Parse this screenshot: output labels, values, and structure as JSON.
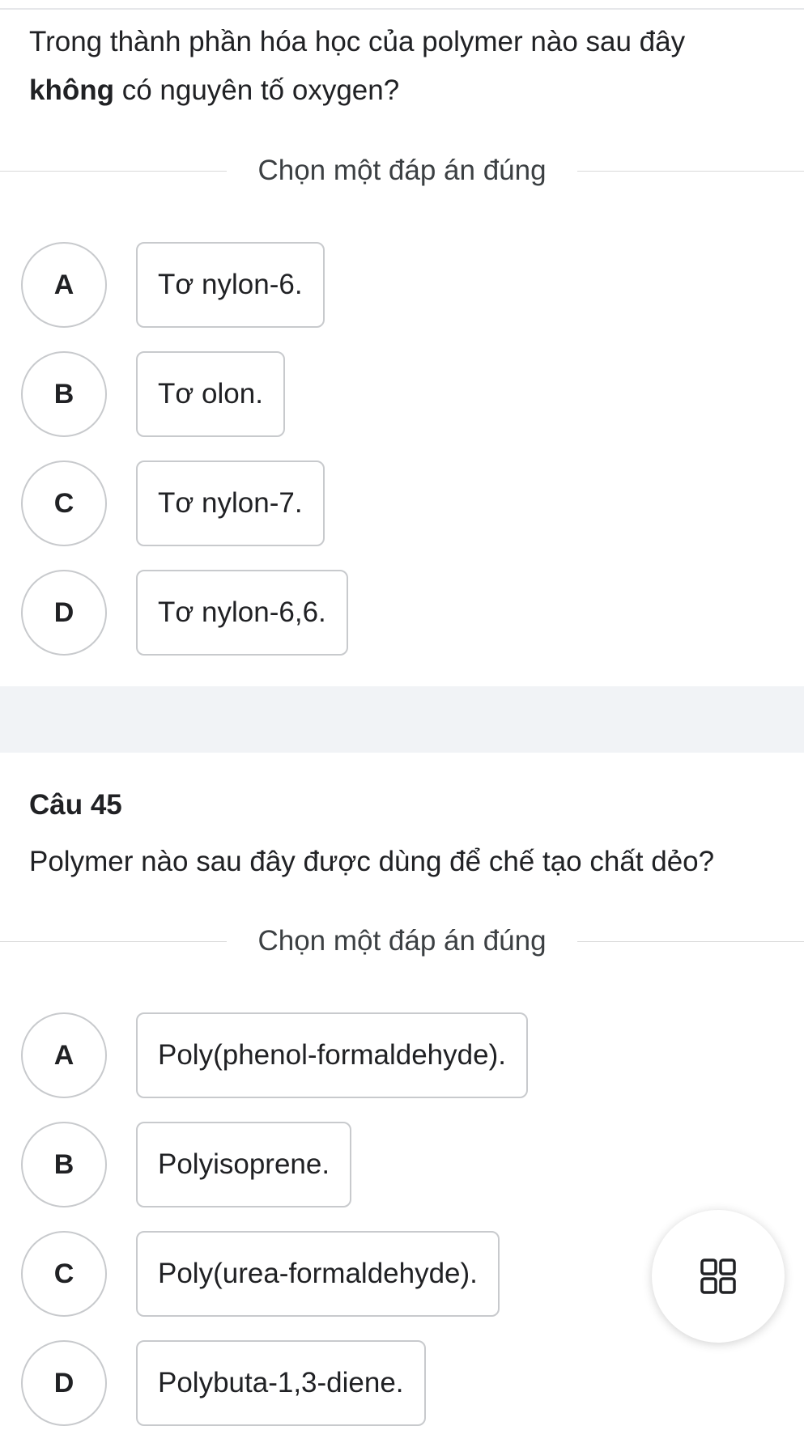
{
  "question1": {
    "text_line1": "Trong thành phần hóa học của polymer nào sau đây",
    "text_line2_bold": "không",
    "text_line2_rest": " có nguyên tố oxygen?",
    "instruction": "Chọn một đáp án đúng",
    "options": [
      {
        "letter": "A",
        "text": "Tơ nylon-6."
      },
      {
        "letter": "B",
        "text": "Tơ olon."
      },
      {
        "letter": "C",
        "text": "Tơ nylon-7."
      },
      {
        "letter": "D",
        "text": "Tơ nylon-6,6."
      }
    ]
  },
  "question2": {
    "number_label": "Câu 45",
    "text": "Polymer nào sau đây được dùng để chế tạo chất dẻo?",
    "instruction": "Chọn một đáp án đúng",
    "options": [
      {
        "letter": "A",
        "text": "Poly(phenol-formaldehyde)."
      },
      {
        "letter": "B",
        "text": "Polyisoprene."
      },
      {
        "letter": "C",
        "text": "Poly(urea-formaldehyde)."
      },
      {
        "letter": "D",
        "text": "Polybuta-1,3-diene."
      }
    ]
  },
  "fab": {
    "icon": "grid-menu-icon"
  },
  "colors": {
    "border": "#c8cacd",
    "band": "#f1f3f6",
    "text": "#202124"
  }
}
